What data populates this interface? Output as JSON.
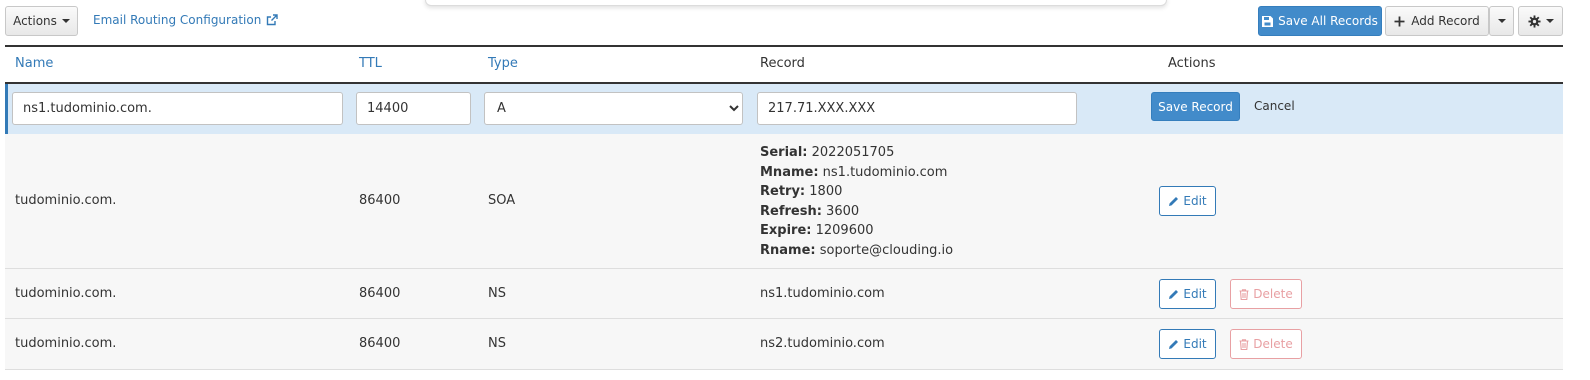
{
  "toolbar": {
    "actions_label": "Actions",
    "email_routing_label": "Email Routing Configuration",
    "save_all_label": "Save All Records",
    "add_record_label": "Add Record"
  },
  "table": {
    "headers": {
      "name": "Name",
      "ttl": "TTL",
      "type": "Type",
      "record": "Record",
      "actions": "Actions"
    },
    "edit_row": {
      "name": "ns1.tudominio.com.",
      "ttl": "14400",
      "type": "A",
      "record": "217.71.XXX.XXX",
      "save_label": "Save Record",
      "cancel_label": "Cancel"
    },
    "rows": [
      {
        "name": "tudominio.com.",
        "ttl": "86400",
        "type": "SOA",
        "soa": [
          {
            "key": "Serial:",
            "value": "2022051705"
          },
          {
            "key": "Mname:",
            "value": "ns1.tudominio.com"
          },
          {
            "key": "Retry:",
            "value": "1800"
          },
          {
            "key": "Refresh:",
            "value": "3600"
          },
          {
            "key": "Expire:",
            "value": "1209600"
          },
          {
            "key": "Rname:",
            "value": "soporte@clouding.io"
          }
        ],
        "edit_label": "Edit"
      },
      {
        "name": "tudominio.com.",
        "ttl": "86400",
        "type": "NS",
        "record": "ns1.tudominio.com",
        "edit_label": "Edit",
        "delete_label": "Delete"
      },
      {
        "name": "tudominio.com.",
        "ttl": "86400",
        "type": "NS",
        "record": "ns2.tudominio.com",
        "edit_label": "Edit",
        "delete_label": "Delete"
      }
    ]
  },
  "colors": {
    "primary": "#428bca",
    "link": "#337ab7",
    "edit_row_bg": "#d9e9f7",
    "delete": "#e8a0a3"
  },
  "icons": [
    "external-link-icon",
    "save-icon",
    "plus-icon",
    "gear-icon",
    "pencil-icon",
    "trash-icon",
    "chevron-down-icon"
  ]
}
